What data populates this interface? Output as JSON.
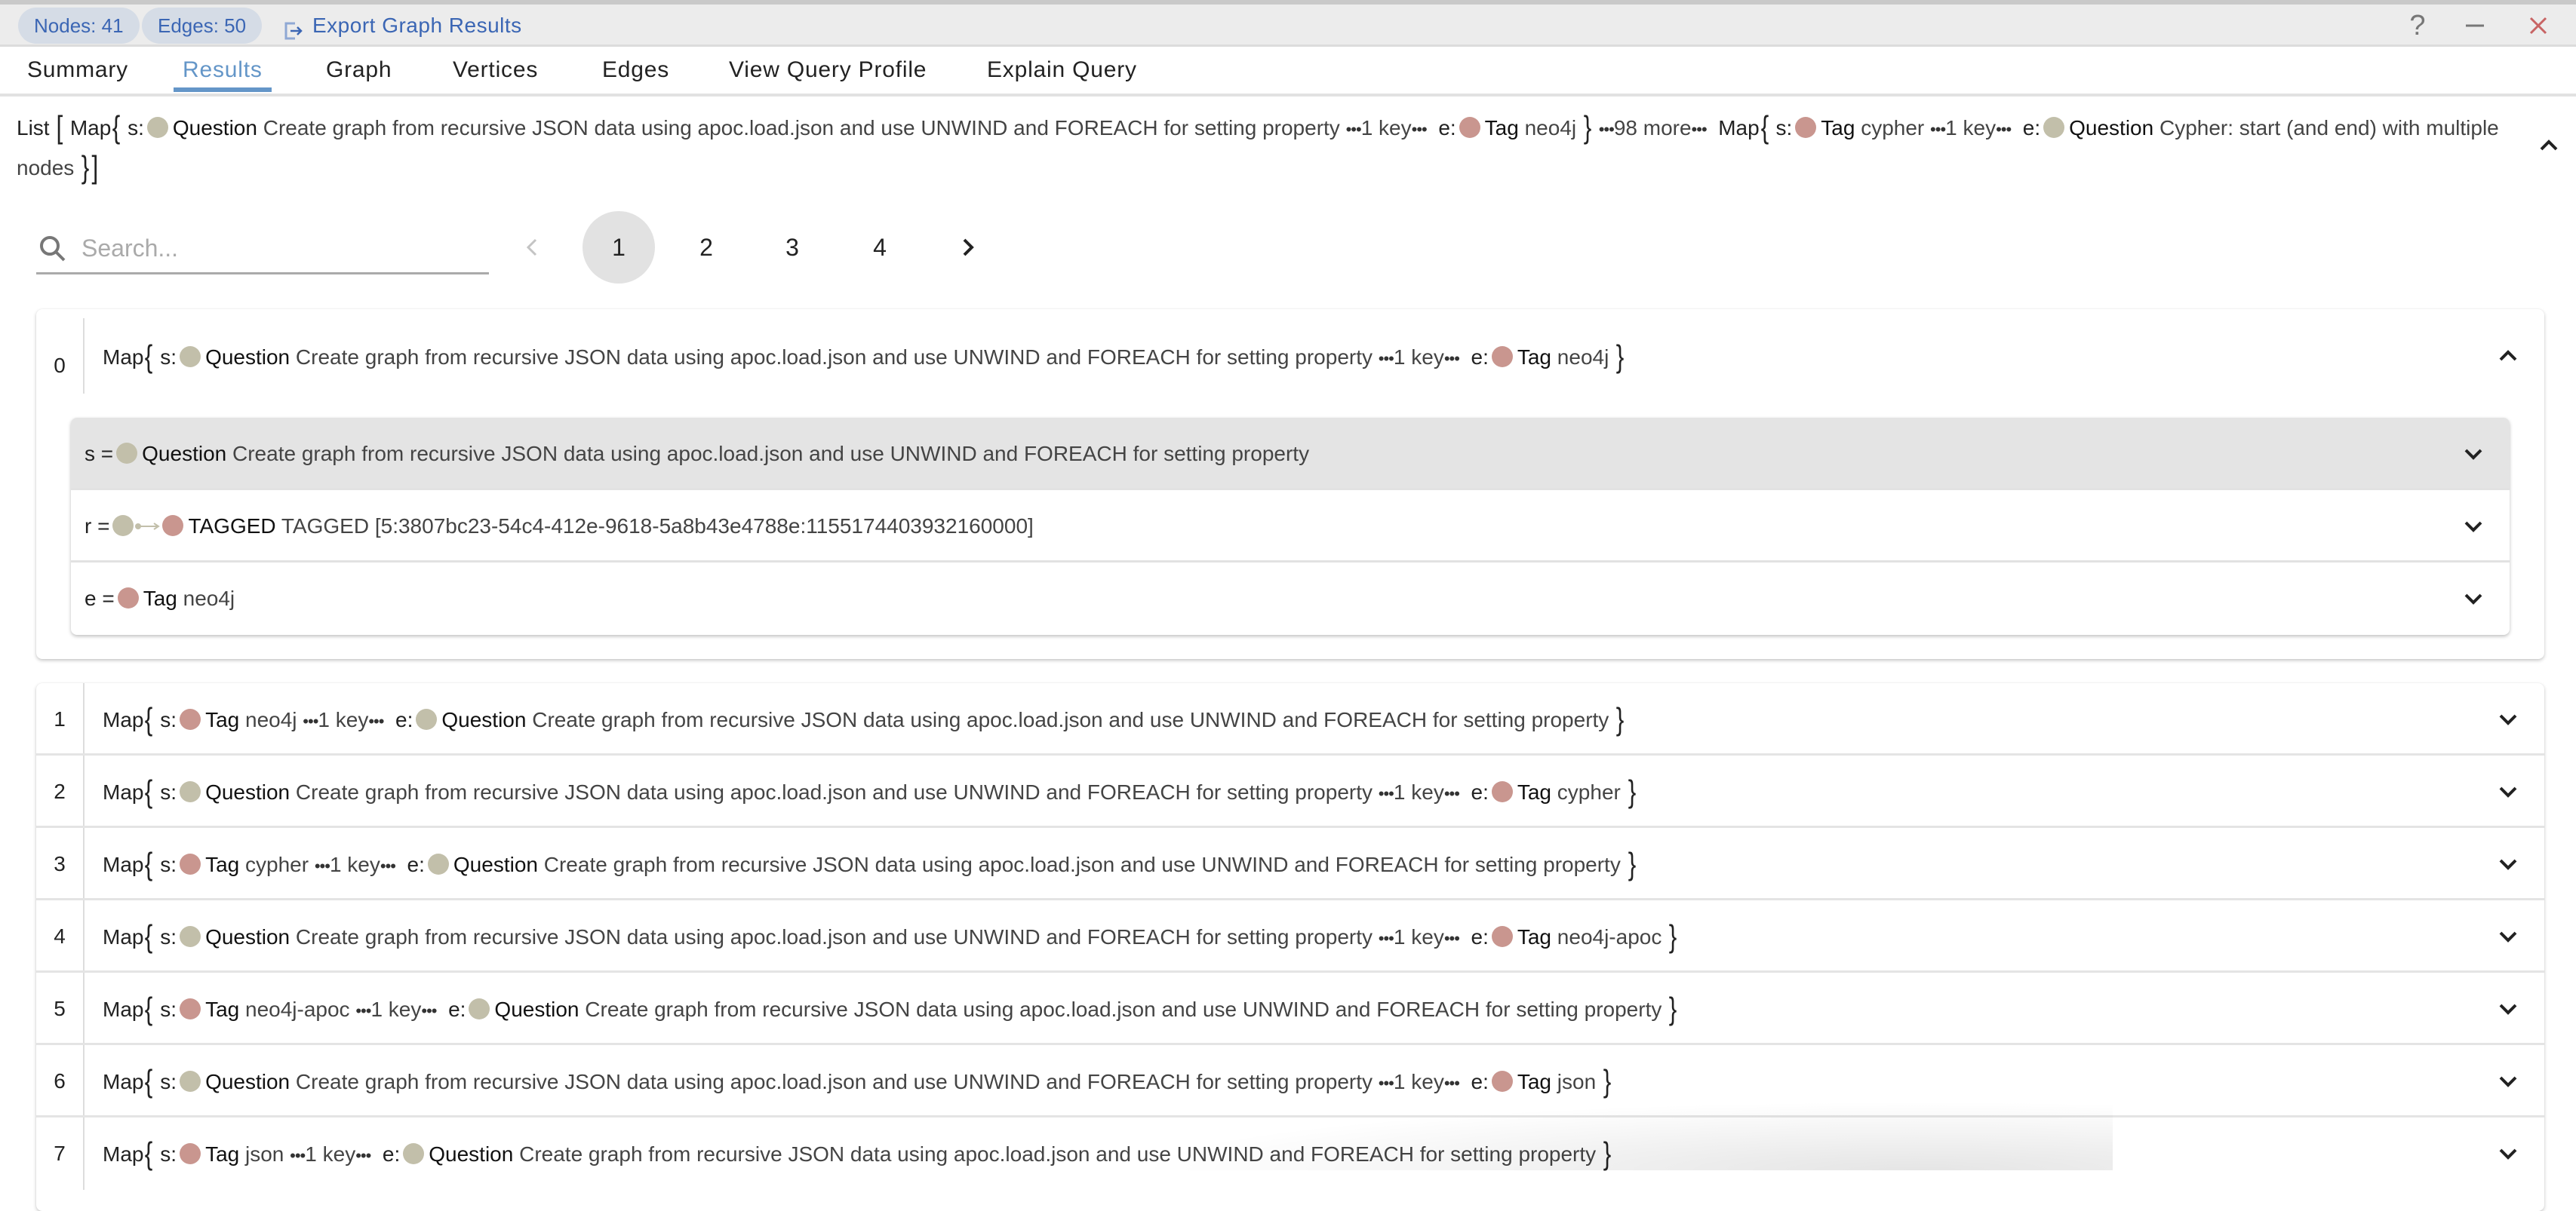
{
  "topbar": {
    "nodes_badge": "Nodes: 41",
    "edges_badge": "Edges: 50",
    "export_label": "Export Graph Results",
    "help_label": "?",
    "minimize_label": "–",
    "close_label": "✕"
  },
  "tabs": [
    {
      "label": "Summary",
      "active": false
    },
    {
      "label": "Results",
      "active": true
    },
    {
      "label": "Graph",
      "active": false
    },
    {
      "label": "Vertices",
      "active": false
    },
    {
      "label": "Edges",
      "active": false
    },
    {
      "label": "View Query Profile",
      "active": false
    },
    {
      "label": "Explain Query",
      "active": false
    }
  ],
  "colors": {
    "accent": "#6496c8",
    "link": "#3b66b4",
    "question_node": "#c2bfaa",
    "tag_node": "#c9968f",
    "close": "#c86464"
  },
  "list_header": {
    "list_word": "List",
    "map_word": "Map",
    "first": {
      "s_label": "Question",
      "s_value": "Create graph from recursive JSON data using apoc.load.json and use UNWIND and FOREACH for setting property",
      "keys": "1 key",
      "e_label": "Tag",
      "e_value": "neo4j"
    },
    "more": "98 more",
    "last": {
      "s_label": "Tag",
      "s_value": "cypher",
      "keys": "1 key",
      "e_label": "Question",
      "e_value": "Cypher: start (and end) with multiple nodes"
    }
  },
  "search": {
    "placeholder": "Search...",
    "value": ""
  },
  "pagination": {
    "pages": [
      "1",
      "2",
      "3",
      "4"
    ],
    "current": "1"
  },
  "rows": [
    {
      "index": "0",
      "s_type": "Question",
      "s_value": "Create graph from recursive JSON data using apoc.load.json and use UNWIND and FOREACH for setting property",
      "keys": "1 key",
      "e_type": "Tag",
      "e_value": "neo4j",
      "expanded": true
    },
    {
      "index": "1",
      "s_type": "Tag",
      "s_value": "neo4j",
      "keys": "1 key",
      "e_type": "Question",
      "e_value": "Create graph from recursive JSON data using apoc.load.json and use UNWIND and FOREACH for setting property"
    },
    {
      "index": "2",
      "s_type": "Question",
      "s_value": "Create graph from recursive JSON data using apoc.load.json and use UNWIND and FOREACH for setting property",
      "keys": "1 key",
      "e_type": "Tag",
      "e_value": "cypher"
    },
    {
      "index": "3",
      "s_type": "Tag",
      "s_value": "cypher",
      "keys": "1 key",
      "e_type": "Question",
      "e_value": "Create graph from recursive JSON data using apoc.load.json and use UNWIND and FOREACH for setting property"
    },
    {
      "index": "4",
      "s_type": "Question",
      "s_value": "Create graph from recursive JSON data using apoc.load.json and use UNWIND and FOREACH for setting property",
      "keys": "1 key",
      "e_type": "Tag",
      "e_value": "neo4j-apoc"
    },
    {
      "index": "5",
      "s_type": "Tag",
      "s_value": "neo4j-apoc",
      "keys": "1 key",
      "e_type": "Question",
      "e_value": "Create graph from recursive JSON data using apoc.load.json and use UNWIND and FOREACH for setting property"
    },
    {
      "index": "6",
      "s_type": "Question",
      "s_value": "Create graph from recursive JSON data using apoc.load.json and use UNWIND and FOREACH for setting property",
      "keys": "1 key",
      "e_type": "Tag",
      "e_value": "json"
    },
    {
      "index": "7",
      "s_type": "Tag",
      "s_value": "json",
      "keys": "1 key",
      "e_type": "Question",
      "e_value": "Create graph from recursive JSON data using apoc.load.json and use UNWIND and FOREACH for setting property"
    }
  ],
  "expanded": {
    "s": {
      "var": "s =",
      "label": "Question",
      "value": "Create graph from recursive JSON data using apoc.load.json and use UNWIND and FOREACH for setting property"
    },
    "r": {
      "var": "r =",
      "label": "TAGGED",
      "value": "TAGGED [5:3807bc23-54c4-412e-9618-5a8b43e4788e:1155174403932160000]"
    },
    "e": {
      "var": "e =",
      "label": "Tag",
      "value": "neo4j"
    }
  },
  "words": {
    "map": "Map",
    "s_key": "s:",
    "e_key": "e:"
  }
}
